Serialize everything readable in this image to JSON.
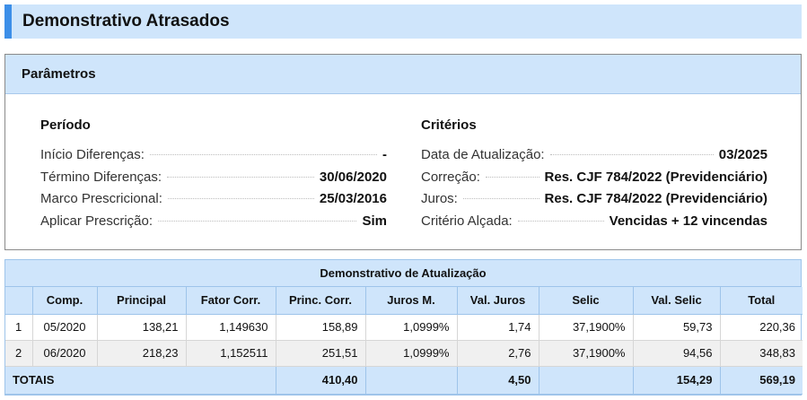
{
  "page": {
    "title": "Demonstrativo Atrasados"
  },
  "params": {
    "heading": "Parâmetros",
    "periodo": {
      "heading": "Período",
      "rows": [
        {
          "label": "Início Diferenças:",
          "value": "-"
        },
        {
          "label": "Término Diferenças:",
          "value": "30/06/2020"
        },
        {
          "label": "Marco Prescricional:",
          "value": "25/03/2016"
        },
        {
          "label": "Aplicar Prescrição:",
          "value": "Sim"
        }
      ]
    },
    "criterios": {
      "heading": "Critérios",
      "rows": [
        {
          "label": "Data de Atualização:",
          "value": "03/2025"
        },
        {
          "label": "Correção:",
          "value": "Res. CJF 784/2022 (Previdenciário)"
        },
        {
          "label": "Juros:",
          "value": "Res. CJF 784/2022 (Previdenciário)"
        },
        {
          "label": "Critério Alçada:",
          "value": "Vencidas + 12 vincendas"
        }
      ]
    }
  },
  "table": {
    "title": "Demonstrativo de Atualização",
    "headers": [
      "",
      "Comp.",
      "Principal",
      "Fator Corr.",
      "Princ. Corr.",
      "Juros M.",
      "Val. Juros",
      "Selic",
      "Val. Selic",
      "Total"
    ],
    "rows": [
      [
        "1",
        "05/2020",
        "138,21",
        "1,149630",
        "158,89",
        "1,0999%",
        "1,74",
        "37,1900%",
        "59,73",
        "220,36"
      ],
      [
        "2",
        "06/2020",
        "218,23",
        "1,152511",
        "251,51",
        "1,0999%",
        "2,76",
        "37,1900%",
        "94,56",
        "348,83"
      ]
    ],
    "totals": {
      "label": "TOTAIS",
      "princ_corr": "410,40",
      "val_juros": "4,50",
      "val_selic": "154,29",
      "total": "569,19"
    }
  },
  "colors": {
    "accent": "#3d8fe8",
    "header_bg": "#cfe5fb"
  }
}
